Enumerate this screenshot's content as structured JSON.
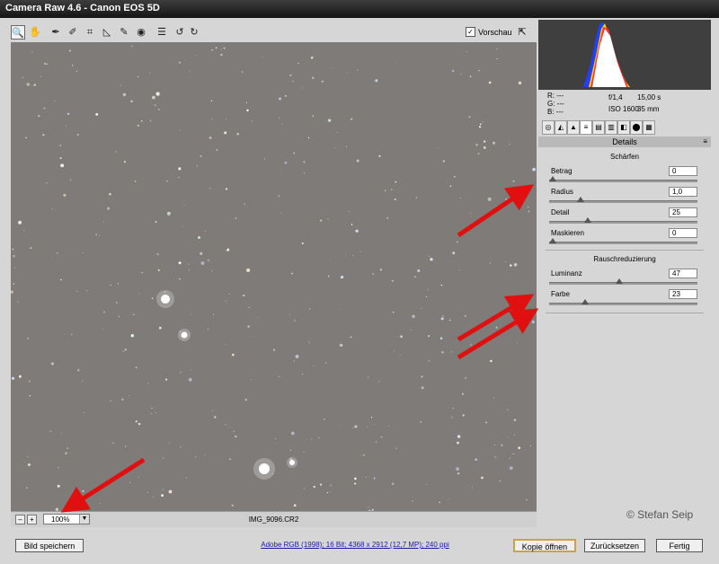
{
  "window": {
    "title": "Camera Raw 4.6 - Canon EOS 5D"
  },
  "toolbar": {
    "tools": [
      {
        "icon": "zoom-icon",
        "glyph": "🔍"
      },
      {
        "icon": "hand-icon",
        "glyph": "✋"
      },
      {
        "icon": "white-balance-icon",
        "glyph": "✒"
      },
      {
        "icon": "color-sampler-icon",
        "glyph": "✐"
      },
      {
        "icon": "crop-icon",
        "glyph": "⌗"
      },
      {
        "icon": "straighten-icon",
        "glyph": "◺"
      },
      {
        "icon": "retouch-icon",
        "glyph": "✎"
      },
      {
        "icon": "red-eye-icon",
        "glyph": "◉"
      },
      {
        "icon": "preferences-icon",
        "glyph": "☰"
      },
      {
        "icon": "rotate-left-icon",
        "glyph": "↺"
      },
      {
        "icon": "rotate-right-icon",
        "glyph": "↻"
      }
    ],
    "preview_label": "Vorschau",
    "preview_checked": "✓"
  },
  "status": {
    "zoom": "100%",
    "filename": "IMG_9096.CR2",
    "minus": "–",
    "plus": "+"
  },
  "info": {
    "r": "R: ---",
    "g": "G: ---",
    "b": "B: ---",
    "aperture": "f/1,4",
    "shutter": "15,00 s",
    "iso": "ISO 1600",
    "focal": "35 mm"
  },
  "panel": {
    "tab_icons": [
      "◎",
      "◭",
      "▲",
      "≡",
      "▤",
      "▥",
      "◧",
      "⬤",
      "▦"
    ],
    "title": "Details",
    "sharpen": {
      "title": "Schärfen",
      "sliders": [
        {
          "label": "Betrag",
          "value": "0",
          "fraction": 0.0
        },
        {
          "label": "Radius",
          "value": "1,0",
          "fraction": 0.2
        },
        {
          "label": "Detail",
          "value": "25",
          "fraction": 0.25
        },
        {
          "label": "Maskieren",
          "value": "0",
          "fraction": 0.0
        }
      ]
    },
    "noise": {
      "title": "Rauschreduzierung",
      "sliders": [
        {
          "label": "Luminanz",
          "value": "47",
          "fraction": 0.47
        },
        {
          "label": "Farbe",
          "value": "23",
          "fraction": 0.23
        }
      ]
    }
  },
  "watermark": "© Stefan Seip",
  "bottom": {
    "save": "Bild speichern",
    "workflow": "Adobe RGB (1998); 16 Bit; 4368 x 2912 (12,7 MP); 240 ppi",
    "open_copy": "Kopie öffnen",
    "reset": "Zurücksetzen",
    "done": "Fertig"
  },
  "colors": {
    "image_bg": "#7e7b78",
    "arrow": "#e01010",
    "default_btn_border": "#c9a24b"
  }
}
